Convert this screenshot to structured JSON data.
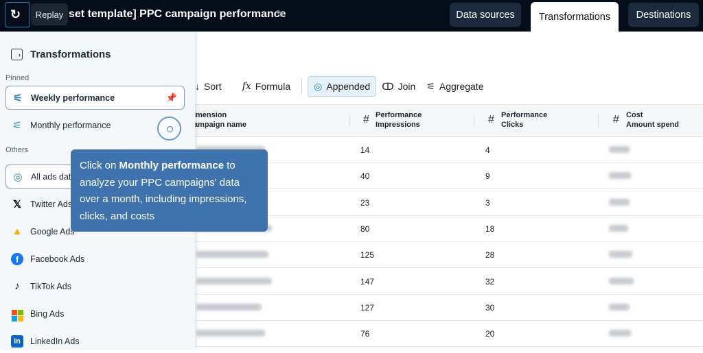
{
  "header": {
    "replay_label": "Replay",
    "title": "[Preset template] PPC campaign performance",
    "title_visible": "set template] PPC campaign performance",
    "tabs": [
      "Data sources",
      "Transformations",
      "Destinations"
    ]
  },
  "sidebar": {
    "title": "Transformations",
    "pinned_label": "Pinned",
    "others_label": "Others",
    "pinned": [
      {
        "label": "Weekly performance"
      },
      {
        "label": "Monthly performance"
      }
    ],
    "others": [
      {
        "label": "All ads data"
      },
      {
        "label": "Twitter Ads"
      },
      {
        "label": "Google Ads"
      },
      {
        "label": "Facebook Ads"
      },
      {
        "label": "TikTok Ads"
      },
      {
        "label": "Bing Ads"
      },
      {
        "label": "LinkedIn Ads"
      }
    ]
  },
  "toolbar": {
    "sort": "Sort",
    "formula": "Formula",
    "appended": "Appended",
    "join": "Join",
    "aggregate": "Aggregate"
  },
  "table": {
    "columns": [
      {
        "l1": "Dimension",
        "l2": "Campaign name"
      },
      {
        "l1": "Performance",
        "l2": "Impressions"
      },
      {
        "l1": "Performance",
        "l2": "Clicks"
      },
      {
        "l1": "Cost",
        "l2": "Amount spend"
      }
    ],
    "rows": [
      {
        "impressions": "14",
        "clicks": "4"
      },
      {
        "impressions": "40",
        "clicks": "9"
      },
      {
        "impressions": "23",
        "clicks": "3"
      },
      {
        "impressions": "80",
        "clicks": "18"
      },
      {
        "impressions": "125",
        "clicks": "28"
      },
      {
        "impressions": "147",
        "clicks": "32"
      },
      {
        "impressions": "127",
        "clicks": "30"
      },
      {
        "impressions": "76",
        "clicks": "20"
      }
    ]
  },
  "tooltip": {
    "pre": "Click on ",
    "bold": "Monthly performance",
    "post": " to analyze your PPC campaigns' data over a month, including impressions, clicks, and costs"
  }
}
